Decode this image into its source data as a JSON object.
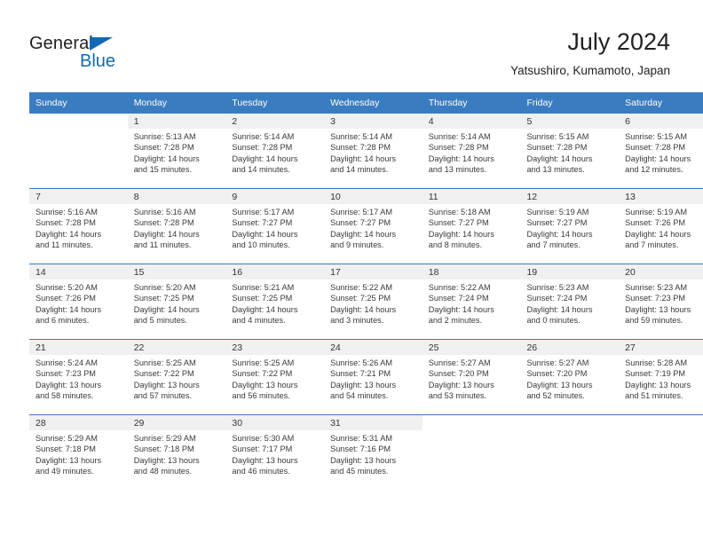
{
  "brand": {
    "name_part1": "General",
    "name_part2": "Blue",
    "triangle_color": "#1268b3"
  },
  "header": {
    "title": "July 2024",
    "subtitle": "Yatsushiro, Kumamoto, Japan",
    "accent_color": "#3a7cc0"
  },
  "weekday_headers": [
    "Sunday",
    "Monday",
    "Tuesday",
    "Wednesday",
    "Thursday",
    "Friday",
    "Saturday"
  ],
  "weeks": [
    [
      {
        "day": "",
        "blank": true,
        "sunrise": "",
        "sunset": "",
        "daylight_line1": "",
        "daylight_line2": ""
      },
      {
        "day": "1",
        "sunrise": "Sunrise: 5:13 AM",
        "sunset": "Sunset: 7:28 PM",
        "daylight_line1": "Daylight: 14 hours",
        "daylight_line2": "and 15 minutes."
      },
      {
        "day": "2",
        "sunrise": "Sunrise: 5:14 AM",
        "sunset": "Sunset: 7:28 PM",
        "daylight_line1": "Daylight: 14 hours",
        "daylight_line2": "and 14 minutes."
      },
      {
        "day": "3",
        "sunrise": "Sunrise: 5:14 AM",
        "sunset": "Sunset: 7:28 PM",
        "daylight_line1": "Daylight: 14 hours",
        "daylight_line2": "and 14 minutes."
      },
      {
        "day": "4",
        "sunrise": "Sunrise: 5:14 AM",
        "sunset": "Sunset: 7:28 PM",
        "daylight_line1": "Daylight: 14 hours",
        "daylight_line2": "and 13 minutes."
      },
      {
        "day": "5",
        "sunrise": "Sunrise: 5:15 AM",
        "sunset": "Sunset: 7:28 PM",
        "daylight_line1": "Daylight: 14 hours",
        "daylight_line2": "and 13 minutes."
      },
      {
        "day": "6",
        "sunrise": "Sunrise: 5:15 AM",
        "sunset": "Sunset: 7:28 PM",
        "daylight_line1": "Daylight: 14 hours",
        "daylight_line2": "and 12 minutes."
      }
    ],
    [
      {
        "day": "7",
        "sunrise": "Sunrise: 5:16 AM",
        "sunset": "Sunset: 7:28 PM",
        "daylight_line1": "Daylight: 14 hours",
        "daylight_line2": "and 11 minutes."
      },
      {
        "day": "8",
        "sunrise": "Sunrise: 5:16 AM",
        "sunset": "Sunset: 7:28 PM",
        "daylight_line1": "Daylight: 14 hours",
        "daylight_line2": "and 11 minutes."
      },
      {
        "day": "9",
        "sunrise": "Sunrise: 5:17 AM",
        "sunset": "Sunset: 7:27 PM",
        "daylight_line1": "Daylight: 14 hours",
        "daylight_line2": "and 10 minutes."
      },
      {
        "day": "10",
        "sunrise": "Sunrise: 5:17 AM",
        "sunset": "Sunset: 7:27 PM",
        "daylight_line1": "Daylight: 14 hours",
        "daylight_line2": "and 9 minutes."
      },
      {
        "day": "11",
        "sunrise": "Sunrise: 5:18 AM",
        "sunset": "Sunset: 7:27 PM",
        "daylight_line1": "Daylight: 14 hours",
        "daylight_line2": "and 8 minutes."
      },
      {
        "day": "12",
        "sunrise": "Sunrise: 5:19 AM",
        "sunset": "Sunset: 7:27 PM",
        "daylight_line1": "Daylight: 14 hours",
        "daylight_line2": "and 7 minutes."
      },
      {
        "day": "13",
        "sunrise": "Sunrise: 5:19 AM",
        "sunset": "Sunset: 7:26 PM",
        "daylight_line1": "Daylight: 14 hours",
        "daylight_line2": "and 7 minutes."
      }
    ],
    [
      {
        "day": "14",
        "sunrise": "Sunrise: 5:20 AM",
        "sunset": "Sunset: 7:26 PM",
        "daylight_line1": "Daylight: 14 hours",
        "daylight_line2": "and 6 minutes."
      },
      {
        "day": "15",
        "sunrise": "Sunrise: 5:20 AM",
        "sunset": "Sunset: 7:25 PM",
        "daylight_line1": "Daylight: 14 hours",
        "daylight_line2": "and 5 minutes."
      },
      {
        "day": "16",
        "sunrise": "Sunrise: 5:21 AM",
        "sunset": "Sunset: 7:25 PM",
        "daylight_line1": "Daylight: 14 hours",
        "daylight_line2": "and 4 minutes."
      },
      {
        "day": "17",
        "sunrise": "Sunrise: 5:22 AM",
        "sunset": "Sunset: 7:25 PM",
        "daylight_line1": "Daylight: 14 hours",
        "daylight_line2": "and 3 minutes."
      },
      {
        "day": "18",
        "sunrise": "Sunrise: 5:22 AM",
        "sunset": "Sunset: 7:24 PM",
        "daylight_line1": "Daylight: 14 hours",
        "daylight_line2": "and 2 minutes."
      },
      {
        "day": "19",
        "sunrise": "Sunrise: 5:23 AM",
        "sunset": "Sunset: 7:24 PM",
        "daylight_line1": "Daylight: 14 hours",
        "daylight_line2": "and 0 minutes."
      },
      {
        "day": "20",
        "sunrise": "Sunrise: 5:23 AM",
        "sunset": "Sunset: 7:23 PM",
        "daylight_line1": "Daylight: 13 hours",
        "daylight_line2": "and 59 minutes."
      }
    ],
    [
      {
        "day": "21",
        "sunrise": "Sunrise: 5:24 AM",
        "sunset": "Sunset: 7:23 PM",
        "daylight_line1": "Daylight: 13 hours",
        "daylight_line2": "and 58 minutes."
      },
      {
        "day": "22",
        "sunrise": "Sunrise: 5:25 AM",
        "sunset": "Sunset: 7:22 PM",
        "daylight_line1": "Daylight: 13 hours",
        "daylight_line2": "and 57 minutes."
      },
      {
        "day": "23",
        "sunrise": "Sunrise: 5:25 AM",
        "sunset": "Sunset: 7:22 PM",
        "daylight_line1": "Daylight: 13 hours",
        "daylight_line2": "and 56 minutes."
      },
      {
        "day": "24",
        "sunrise": "Sunrise: 5:26 AM",
        "sunset": "Sunset: 7:21 PM",
        "daylight_line1": "Daylight: 13 hours",
        "daylight_line2": "and 54 minutes."
      },
      {
        "day": "25",
        "sunrise": "Sunrise: 5:27 AM",
        "sunset": "Sunset: 7:20 PM",
        "daylight_line1": "Daylight: 13 hours",
        "daylight_line2": "and 53 minutes."
      },
      {
        "day": "26",
        "sunrise": "Sunrise: 5:27 AM",
        "sunset": "Sunset: 7:20 PM",
        "daylight_line1": "Daylight: 13 hours",
        "daylight_line2": "and 52 minutes."
      },
      {
        "day": "27",
        "sunrise": "Sunrise: 5:28 AM",
        "sunset": "Sunset: 7:19 PM",
        "daylight_line1": "Daylight: 13 hours",
        "daylight_line2": "and 51 minutes."
      }
    ],
    [
      {
        "day": "28",
        "sunrise": "Sunrise: 5:29 AM",
        "sunset": "Sunset: 7:18 PM",
        "daylight_line1": "Daylight: 13 hours",
        "daylight_line2": "and 49 minutes."
      },
      {
        "day": "29",
        "sunrise": "Sunrise: 5:29 AM",
        "sunset": "Sunset: 7:18 PM",
        "daylight_line1": "Daylight: 13 hours",
        "daylight_line2": "and 48 minutes."
      },
      {
        "day": "30",
        "sunrise": "Sunrise: 5:30 AM",
        "sunset": "Sunset: 7:17 PM",
        "daylight_line1": "Daylight: 13 hours",
        "daylight_line2": "and 46 minutes."
      },
      {
        "day": "31",
        "sunrise": "Sunrise: 5:31 AM",
        "sunset": "Sunset: 7:16 PM",
        "daylight_line1": "Daylight: 13 hours",
        "daylight_line2": "and 45 minutes."
      },
      {
        "day": "",
        "blank": true,
        "sunrise": "",
        "sunset": "",
        "daylight_line1": "",
        "daylight_line2": ""
      },
      {
        "day": "",
        "blank": true,
        "sunrise": "",
        "sunset": "",
        "daylight_line1": "",
        "daylight_line2": ""
      },
      {
        "day": "",
        "blank": true,
        "sunrise": "",
        "sunset": "",
        "daylight_line1": "",
        "daylight_line2": ""
      }
    ]
  ]
}
